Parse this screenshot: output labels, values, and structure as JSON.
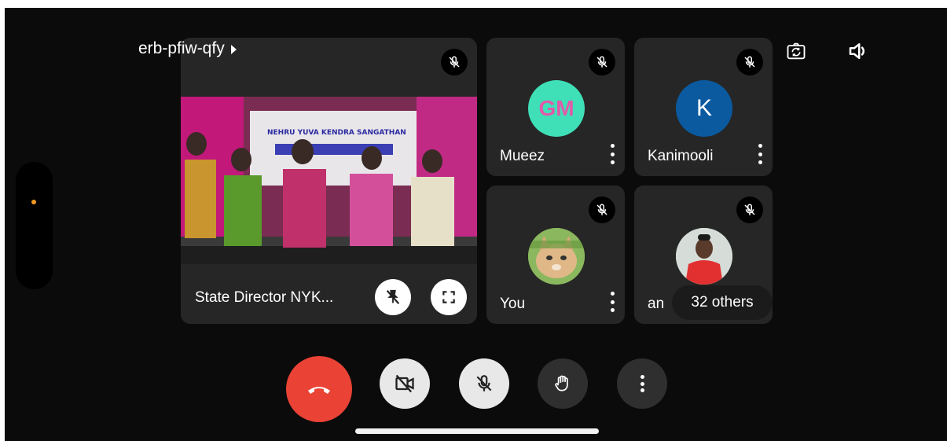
{
  "meeting": {
    "code": "erb-pfiw-qfy"
  },
  "top_icons": {
    "camera_switch": "camera-switch-icon",
    "speaker": "speaker-icon"
  },
  "participants": {
    "featured": {
      "name": "State Director NYK...",
      "banner_line1": "NEHRU YUVA KENDRA SANGATHAN",
      "muted": true
    },
    "mueez": {
      "name": "Mueez",
      "initials": "GM",
      "avatar_color": "#3fe0b8",
      "initials_color": "#e05aa8"
    },
    "kanimooli": {
      "name": "Kanimooli",
      "initials": "K",
      "avatar_color": "#0b5aa0",
      "initials_color": "#ffffff"
    },
    "you": {
      "name": "You"
    },
    "fourth": {
      "name": "an"
    },
    "others_count": "32 others"
  },
  "colors": {
    "end_call": "#ea4335",
    "control_light": "#e8e8e8",
    "control_dark": "#2f2f2f",
    "tile_bg": "#262626"
  }
}
